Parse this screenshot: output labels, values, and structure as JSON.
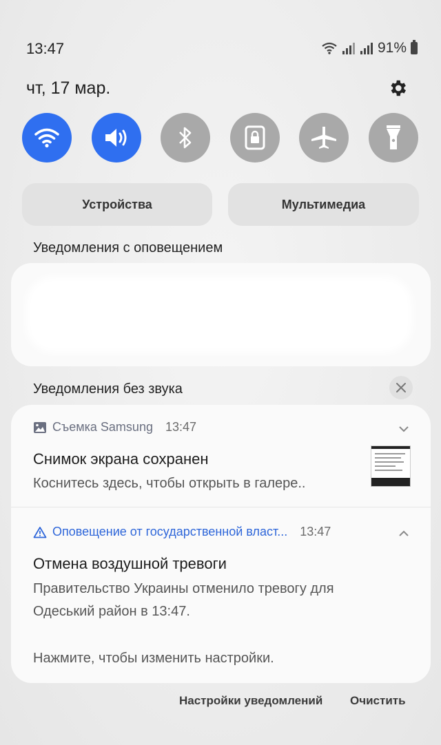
{
  "status_bar": {
    "time": "13:47",
    "battery": "91%"
  },
  "date": "чт, 17 мар.",
  "quick_settings": [
    {
      "name": "wifi-icon",
      "active": true
    },
    {
      "name": "sound-icon",
      "active": true
    },
    {
      "name": "bluetooth-icon",
      "active": false
    },
    {
      "name": "rotation-lock-icon",
      "active": false
    },
    {
      "name": "airplane-icon",
      "active": false
    },
    {
      "name": "flashlight-icon",
      "active": false
    }
  ],
  "buttons": {
    "devices": "Устройства",
    "media": "Мультимедиа"
  },
  "sections": {
    "alerting": "Уведомления с оповещением",
    "silent": "Уведомления без звука"
  },
  "notifications": [
    {
      "app": "Съемка Samsung",
      "time": "13:47",
      "title": "Снимок экрана сохранен",
      "text": "Коснитесь здесь, чтобы открыть в галере.."
    },
    {
      "app": "Оповещение от государственной власт...",
      "time": "13:47",
      "title": "Отмена воздушной тревоги",
      "text_line1": "Правительство Украины отменило тревогу для",
      "text_line2": "Одеський район в 13:47.",
      "footer": "Нажмите, чтобы изменить настройки."
    }
  ],
  "footer": {
    "settings": "Настройки уведомлений",
    "clear": "Очистить"
  },
  "colors": {
    "accent": "#2f6ff0",
    "inactive_tile": "#a9a9a9"
  }
}
